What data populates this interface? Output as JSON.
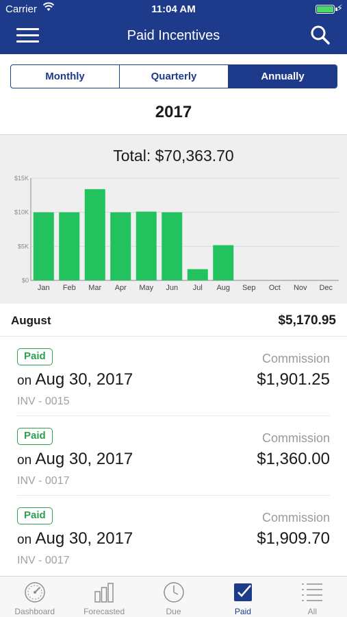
{
  "status_bar": {
    "carrier": "Carrier",
    "time": "11:04 AM"
  },
  "navbar": {
    "title": "Paid Incentives"
  },
  "period_tabs": [
    {
      "label": "Monthly",
      "active": false
    },
    {
      "label": "Quarterly",
      "active": false
    },
    {
      "label": "Annually",
      "active": true
    }
  ],
  "year": "2017",
  "total_label": "Total: $70,363.70",
  "chart_data": {
    "type": "bar",
    "categories": [
      "Jan",
      "Feb",
      "Mar",
      "Apr",
      "May",
      "Jun",
      "Jul",
      "Aug",
      "Sep",
      "Oct",
      "Nov",
      "Dec"
    ],
    "values": [
      10000,
      10000,
      13400,
      10000,
      10100,
      10000,
      1650,
      5170.95,
      0,
      0,
      0,
      0
    ],
    "ylim": [
      0,
      15000
    ],
    "yticks": [
      {
        "value": 0,
        "label": "$0"
      },
      {
        "value": 5000,
        "label": "$5K"
      },
      {
        "value": 10000,
        "label": "$10K"
      },
      {
        "value": 15000,
        "label": "$15K"
      }
    ],
    "grid": true,
    "bar_color": "#22c35e"
  },
  "selected_month": {
    "name": "August",
    "amount": "$5,170.95"
  },
  "payments": [
    {
      "status": "Paid",
      "on": "on",
      "date": "Aug 30, 2017",
      "invoice": "INV - 0015",
      "type": "Commission",
      "amount": "$1,901.25"
    },
    {
      "status": "Paid",
      "on": "on",
      "date": "Aug 30, 2017",
      "invoice": "INV - 0017",
      "type": "Commission",
      "amount": "$1,360.00"
    },
    {
      "status": "Paid",
      "on": "on",
      "date": "Aug 30, 2017",
      "invoice": "INV - 0017",
      "type": "Commission",
      "amount": "$1,909.70"
    }
  ],
  "tabbar": [
    {
      "label": "Dashboard",
      "icon": "speedometer-icon",
      "active": false
    },
    {
      "label": "Forecasted",
      "icon": "bar-chart-icon",
      "active": false
    },
    {
      "label": "Due",
      "icon": "clock-icon",
      "active": false
    },
    {
      "label": "Paid",
      "icon": "checkbox-icon",
      "active": true
    },
    {
      "label": "All",
      "icon": "list-icon",
      "active": false
    }
  ],
  "colors": {
    "primary": "#1e3a8a",
    "bar": "#22c35e",
    "paid_badge": "#2e9e4f",
    "battery": "#4cd964"
  }
}
